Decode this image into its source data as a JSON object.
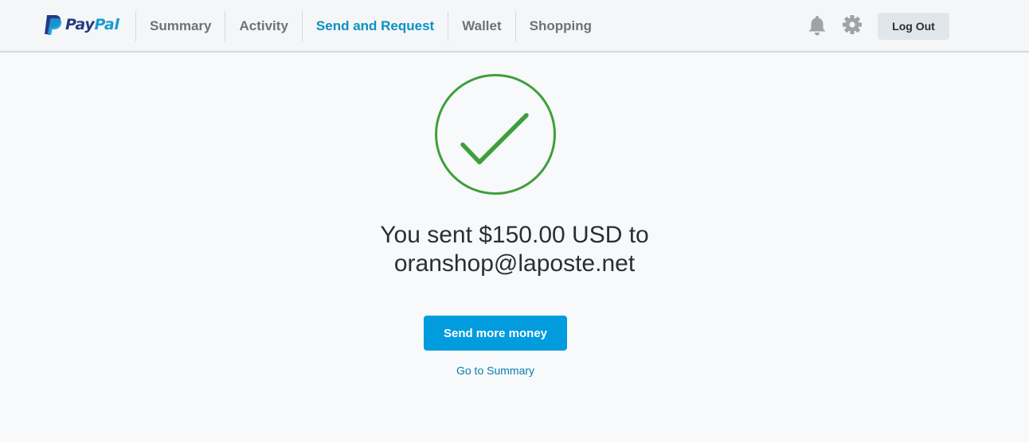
{
  "brand": {
    "name_part1": "Pay",
    "name_part2": "Pal",
    "color_dark": "#253b80",
    "color_light": "#179bd7"
  },
  "nav": {
    "items": [
      {
        "label": "Summary",
        "active": false
      },
      {
        "label": "Activity",
        "active": false
      },
      {
        "label": "Send and Request",
        "active": true
      },
      {
        "label": "Wallet",
        "active": false
      },
      {
        "label": "Shopping",
        "active": false
      }
    ],
    "active_color": "#0a91c5"
  },
  "header": {
    "icons": [
      "bell-icon",
      "gear-icon"
    ],
    "logout_label": "Log Out"
  },
  "confirmation": {
    "icon": "checkmark-icon",
    "icon_color": "#3e9f3b",
    "line1": "You sent $150.00 USD to",
    "line2": "oranshop@laposte.net",
    "send_more_label": "Send more money",
    "summary_link_label": "Go to Summary",
    "button_color": "#009cde"
  }
}
